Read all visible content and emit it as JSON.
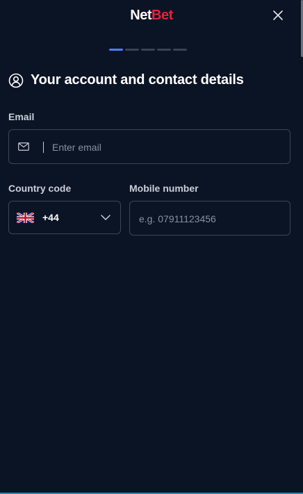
{
  "header": {
    "logo_part1": "Net",
    "logo_part2": "Bet",
    "close_icon": "close-icon"
  },
  "progress": {
    "total_steps": 5,
    "current_step": 1
  },
  "section": {
    "title": "Your account and contact details",
    "icon": "user-circle-icon"
  },
  "email": {
    "label": "Email",
    "placeholder": "Enter email",
    "value": "",
    "icon": "mail-icon"
  },
  "country": {
    "label": "Country code",
    "value": "+44",
    "flag": "uk-flag-icon"
  },
  "mobile": {
    "label": "Mobile number",
    "placeholder": "e.g. 07911123456",
    "value": ""
  },
  "colors": {
    "background": "#0b1424",
    "brand_red": "#e0263b",
    "accent_blue": "#4d7cff",
    "border": "#3c4656"
  }
}
